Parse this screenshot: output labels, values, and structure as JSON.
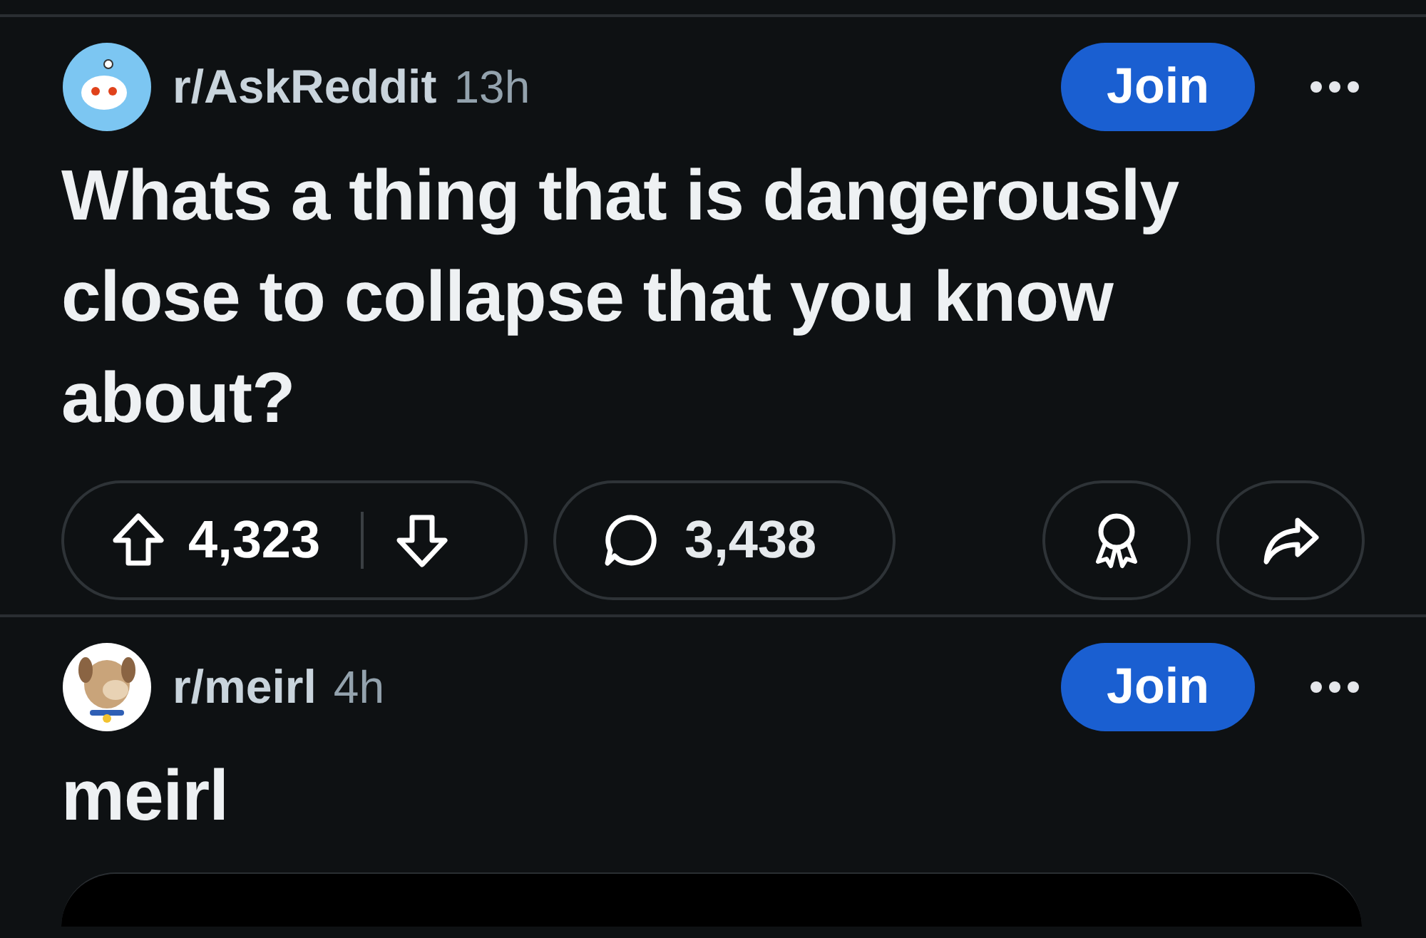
{
  "posts": [
    {
      "avatar": {
        "kind": "question"
      },
      "subreddit": "r/AskReddit",
      "age": "13h",
      "join": "Join",
      "title": "Whats a thing that is dangerously close to collapse that you know about?",
      "actions": {
        "votes": "4,323",
        "comments": "3,438"
      }
    },
    {
      "avatar": {
        "kind": "dog"
      },
      "subreddit": "r/meirl",
      "age": "4h",
      "join": "Join",
      "title": "meirl"
    }
  ]
}
